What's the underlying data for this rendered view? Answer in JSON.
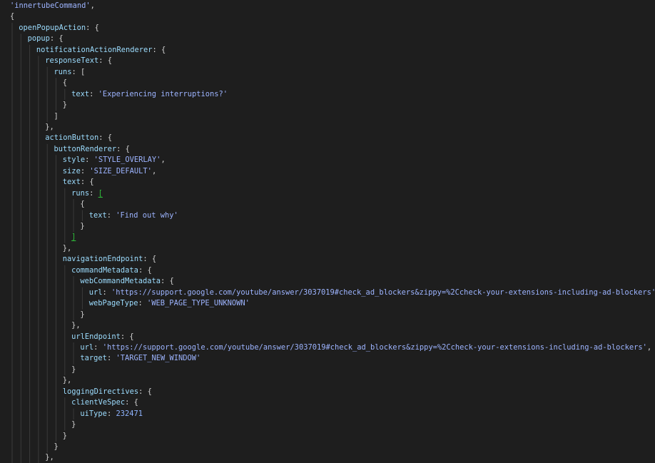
{
  "editor": {
    "theme": {
      "background": "#1e1e1e",
      "key": "#9cdcfe",
      "string": "#9db4ff",
      "number": "#8fb4ff",
      "punctuation": "#d4d4d4",
      "bracket_match": "#2fbf3a"
    },
    "lines": [
      [
        {
          "t": "str",
          "v": "'innertubeCommand'"
        },
        {
          "t": "punc",
          "v": ","
        }
      ],
      [
        {
          "t": "punc",
          "v": "{"
        }
      ],
      [
        {
          "t": "key",
          "v": "openPopupAction"
        },
        {
          "t": "punc",
          "v": ": {"
        }
      ],
      [
        {
          "t": "key",
          "v": "popup"
        },
        {
          "t": "punc",
          "v": ": {"
        }
      ],
      [
        {
          "t": "key",
          "v": "notificationActionRenderer"
        },
        {
          "t": "punc",
          "v": ": {"
        }
      ],
      [
        {
          "t": "key",
          "v": "responseText"
        },
        {
          "t": "punc",
          "v": ": {"
        }
      ],
      [
        {
          "t": "key",
          "v": "runs"
        },
        {
          "t": "punc",
          "v": ": ["
        }
      ],
      [
        {
          "t": "punc",
          "v": "{"
        }
      ],
      [
        {
          "t": "key",
          "v": "text"
        },
        {
          "t": "punc",
          "v": ": "
        },
        {
          "t": "str",
          "v": "'Experiencing interruptions?'"
        }
      ],
      [
        {
          "t": "punc",
          "v": "}"
        }
      ],
      [
        {
          "t": "punc",
          "v": "]"
        }
      ],
      [
        {
          "t": "punc",
          "v": "},"
        }
      ],
      [
        {
          "t": "key",
          "v": "actionButton"
        },
        {
          "t": "punc",
          "v": ": {"
        }
      ],
      [
        {
          "t": "key",
          "v": "buttonRenderer"
        },
        {
          "t": "punc",
          "v": ": {"
        }
      ],
      [
        {
          "t": "key",
          "v": "style"
        },
        {
          "t": "punc",
          "v": ": "
        },
        {
          "t": "str",
          "v": "'STYLE_OVERLAY'"
        },
        {
          "t": "punc",
          "v": ","
        }
      ],
      [
        {
          "t": "key",
          "v": "size"
        },
        {
          "t": "punc",
          "v": ": "
        },
        {
          "t": "str",
          "v": "'SIZE_DEFAULT'"
        },
        {
          "t": "punc",
          "v": ","
        }
      ],
      [
        {
          "t": "key",
          "v": "text"
        },
        {
          "t": "punc",
          "v": ": {"
        }
      ],
      [
        {
          "t": "key",
          "v": "runs"
        },
        {
          "t": "punc",
          "v": ": "
        },
        {
          "t": "hl",
          "v": "["
        }
      ],
      [
        {
          "t": "punc",
          "v": "{"
        }
      ],
      [
        {
          "t": "key",
          "v": "text"
        },
        {
          "t": "punc",
          "v": ": "
        },
        {
          "t": "str",
          "v": "'Find out why'"
        }
      ],
      [
        {
          "t": "punc",
          "v": "}"
        }
      ],
      [
        {
          "t": "hl",
          "v": "]"
        }
      ],
      [
        {
          "t": "punc",
          "v": "},"
        }
      ],
      [
        {
          "t": "key",
          "v": "navigationEndpoint"
        },
        {
          "t": "punc",
          "v": ": {"
        }
      ],
      [
        {
          "t": "key",
          "v": "commandMetadata"
        },
        {
          "t": "punc",
          "v": ": {"
        }
      ],
      [
        {
          "t": "key",
          "v": "webCommandMetadata"
        },
        {
          "t": "punc",
          "v": ": {"
        }
      ],
      [
        {
          "t": "key",
          "v": "url"
        },
        {
          "t": "punc",
          "v": ": "
        },
        {
          "t": "str",
          "v": "'https://support.google.com/youtube/answer/3037019#check_ad_blockers&zippy=%2Ccheck-your-extensions-including-ad-blockers'"
        },
        {
          "t": "punc",
          "v": ","
        }
      ],
      [
        {
          "t": "key",
          "v": "webPageType"
        },
        {
          "t": "punc",
          "v": ": "
        },
        {
          "t": "str",
          "v": "'WEB_PAGE_TYPE_UNKNOWN'"
        }
      ],
      [
        {
          "t": "punc",
          "v": "}"
        }
      ],
      [
        {
          "t": "punc",
          "v": "},"
        }
      ],
      [
        {
          "t": "key",
          "v": "urlEndpoint"
        },
        {
          "t": "punc",
          "v": ": {"
        }
      ],
      [
        {
          "t": "key",
          "v": "url"
        },
        {
          "t": "punc",
          "v": ": "
        },
        {
          "t": "str",
          "v": "'https://support.google.com/youtube/answer/3037019#check_ad_blockers&zippy=%2Ccheck-your-extensions-including-ad-blockers'"
        },
        {
          "t": "punc",
          "v": ","
        }
      ],
      [
        {
          "t": "key",
          "v": "target"
        },
        {
          "t": "punc",
          "v": ": "
        },
        {
          "t": "str",
          "v": "'TARGET_NEW_WINDOW'"
        }
      ],
      [
        {
          "t": "punc",
          "v": "}"
        }
      ],
      [
        {
          "t": "punc",
          "v": "},"
        }
      ],
      [
        {
          "t": "key",
          "v": "loggingDirectives"
        },
        {
          "t": "punc",
          "v": ": {"
        }
      ],
      [
        {
          "t": "key",
          "v": "clientVeSpec"
        },
        {
          "t": "punc",
          "v": ": {"
        }
      ],
      [
        {
          "t": "key",
          "v": "uiType"
        },
        {
          "t": "punc",
          "v": ": "
        },
        {
          "t": "num2",
          "v": "232471"
        }
      ],
      [
        {
          "t": "punc",
          "v": "}"
        }
      ],
      [
        {
          "t": "punc",
          "v": "}"
        }
      ],
      [
        {
          "t": "punc",
          "v": "}"
        }
      ],
      [
        {
          "t": "punc",
          "v": "},"
        }
      ]
    ]
  }
}
